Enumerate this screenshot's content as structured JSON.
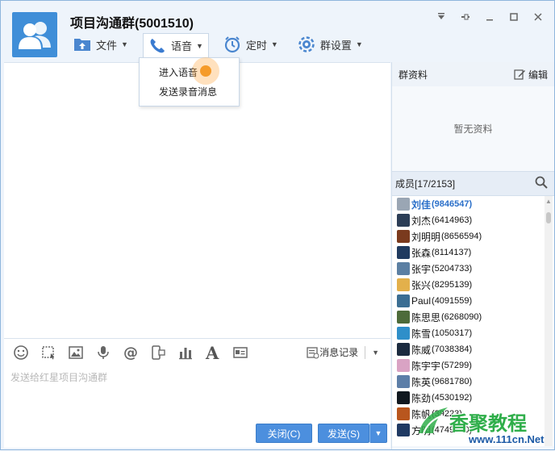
{
  "window": {
    "title": "项目沟通群(5001510)",
    "controls": [
      "pin-down-icon",
      "pin-icon",
      "minimize-icon",
      "maximize-icon",
      "close-icon"
    ]
  },
  "toolbar": {
    "items": [
      {
        "label": "文件",
        "icon": "folder-upload-icon"
      },
      {
        "label": "语音",
        "icon": "phone-icon"
      },
      {
        "label": "定时",
        "icon": "alarm-clock-icon"
      },
      {
        "label": "群设置",
        "icon": "gear-icon"
      }
    ]
  },
  "voice_menu": {
    "items": [
      "进入语音",
      "发送录音消息"
    ]
  },
  "input_toolbar": {
    "icons": [
      "emoji-icon",
      "screenshot-icon",
      "image-icon",
      "microphone-icon",
      "mention-icon",
      "phone-send-icon",
      "chart-icon",
      "font-icon",
      "card-icon"
    ],
    "history_label": "消息记录"
  },
  "input": {
    "placeholder": "发送给红星项目沟通群"
  },
  "buttons": {
    "close": "关闭(C)",
    "send": "发送(S)"
  },
  "side": {
    "info_title": "群资料",
    "edit_label": "编辑",
    "no_info": "暂无资料",
    "members_title": "成员[17/2153]"
  },
  "members": [
    {
      "name": "刘佳",
      "id": "(9846547)",
      "color": "#9aa6b4"
    },
    {
      "name": "刘杰",
      "id": "(6414963)",
      "color": "#2c3e57"
    },
    {
      "name": "刘明明",
      "id": "(8656594)",
      "color": "#7a3a1e"
    },
    {
      "name": "张森",
      "id": "(8114137)",
      "color": "#1f3a5f"
    },
    {
      "name": "张宇",
      "id": "(5204733)",
      "color": "#5b7fa3"
    },
    {
      "name": "张兴",
      "id": "(8295139)",
      "color": "#e3b04b"
    },
    {
      "name": "Paul",
      "id": "(4091559)",
      "color": "#3b6e93"
    },
    {
      "name": "陈思思",
      "id": "(6268090)",
      "color": "#4d6b3a"
    },
    {
      "name": "陈雪",
      "id": "(1050317)",
      "color": "#2f8fc9"
    },
    {
      "name": "陈威",
      "id": "(7038384)",
      "color": "#1b2b40"
    },
    {
      "name": "陈宇宇",
      "id": "(57299)",
      "color": "#d9a3c4"
    },
    {
      "name": "陈英",
      "id": "(9681780)",
      "color": "#5c7ea8"
    },
    {
      "name": "陈劲",
      "id": "(4530192)",
      "color": "#101820"
    },
    {
      "name": "陈帆",
      "id": "(39223)",
      "color": "#b8561e"
    },
    {
      "name": "方明",
      "id": "(4749840)",
      "color": "#203a63"
    }
  ],
  "watermark": {
    "text": "香聚教程",
    "url": "www.111cn.Net"
  }
}
